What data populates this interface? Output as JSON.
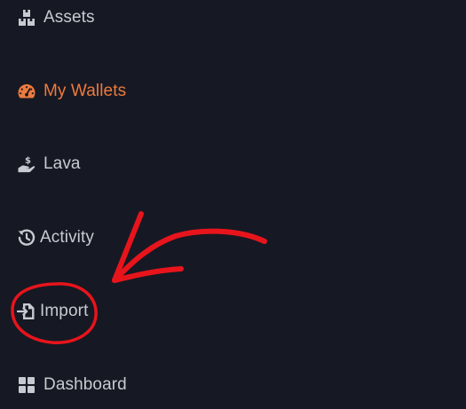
{
  "sidebar": {
    "items": [
      {
        "label": "Assets",
        "icon": "assets-icon"
      },
      {
        "label": "My Wallets",
        "icon": "gauge-icon",
        "active": true
      },
      {
        "label": "Lava",
        "icon": "hand-dollar-icon"
      },
      {
        "label": "Activity",
        "icon": "history-icon"
      },
      {
        "label": "Import",
        "icon": "import-icon"
      },
      {
        "label": "Dashboard",
        "icon": "grid-icon"
      }
    ]
  },
  "colors": {
    "background": "#161923",
    "text": "#c8cad1",
    "active": "#ee7a3d",
    "annotation": "#e8141c"
  }
}
